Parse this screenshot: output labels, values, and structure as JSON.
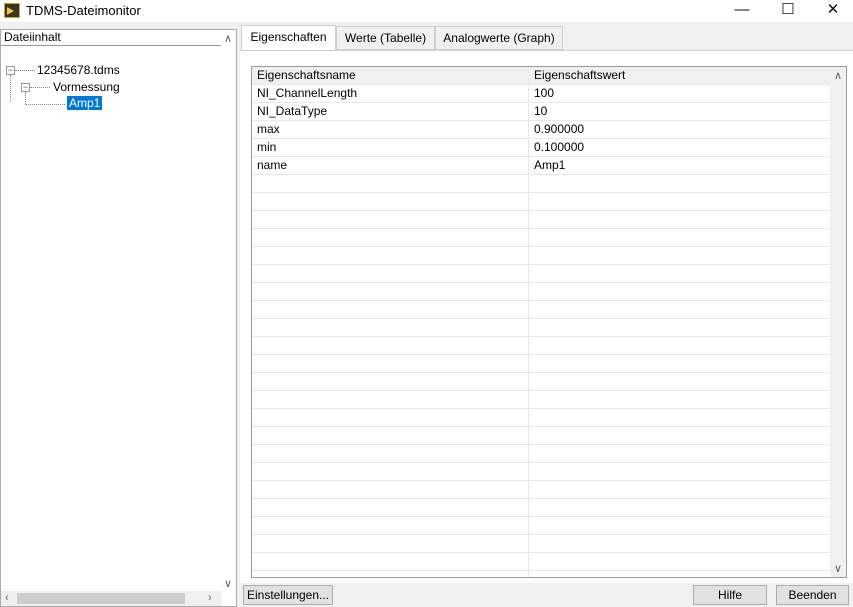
{
  "window": {
    "title": "TDMS-Dateimonitor",
    "minimize": "—",
    "maximize": "☐",
    "close": "✕"
  },
  "tree": {
    "header": "Dateiinhalt",
    "file": "12345678.tdms",
    "group": "Vormessung",
    "channel": "Amp1"
  },
  "tabs": [
    {
      "label": "Eigenschaften"
    },
    {
      "label": "Werte (Tabelle)"
    },
    {
      "label": "Analogwerte (Graph)"
    }
  ],
  "table": {
    "headers": [
      "Eigenschaftsname",
      "Eigenschaftswert"
    ],
    "rows": [
      [
        "NI_ChannelLength",
        "100"
      ],
      [
        "NI_DataType",
        "10"
      ],
      [
        "max",
        "0.900000"
      ],
      [
        "min",
        "0.100000"
      ],
      [
        "name",
        "Amp1"
      ]
    ]
  },
  "buttons": {
    "settings": "Einstellungen...",
    "help": "Hilfe",
    "quit": "Beenden"
  }
}
